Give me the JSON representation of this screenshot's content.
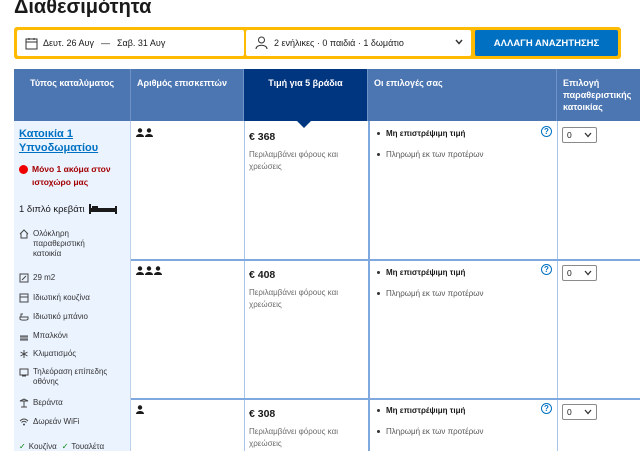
{
  "page": {
    "title": "Διαθεσιμότητα"
  },
  "search": {
    "checkin": "Δευτ. 26 Αυγ",
    "separator": "—",
    "checkout": "Σαβ. 31 Αυγ",
    "guests": "2 ενήλικες · 0 παιδιά · 1 δωμάτιο",
    "button": "ΑΛΛΑΓΗ ΑΝΑΖΗΤΗΣΗΣ"
  },
  "table": {
    "headers": [
      "Τύπος καταλύματος",
      "Αριθμός επισκεπτών",
      "Τιμή για 5 βράδια",
      "Οι επιλογές σας",
      "Επιλογή παραθεριστικής κατοικίας"
    ]
  },
  "room": {
    "name": "Κατοικία 1 Υπνοδωματίου",
    "scarcity": "Μόνο 1 ακόμα στον ιστοχώρο μας",
    "bed": "1 διπλό κρεβάτι",
    "facilities": [
      {
        "label": "Ολόκληρη παραθεριστική κατοικία",
        "icon": "house-icon"
      },
      {
        "label": "29 m2",
        "icon": "size-icon"
      },
      {
        "label": "Ιδιωτική κουζίνα",
        "icon": "kitchen-icon"
      },
      {
        "label": "Ιδιωτικό μπάνιο",
        "icon": "bath-icon"
      },
      {
        "label": "Μπαλκόνι",
        "icon": "balcony-icon"
      },
      {
        "label": "Κλιματισμός",
        "icon": "snowflake-icon"
      },
      {
        "label": "Τηλεόραση επίπεδης οθόνης",
        "icon": "tv-icon"
      },
      {
        "label": "Βεράντα",
        "icon": "terrace-icon"
      },
      {
        "label": "Δωρεάν WiFi",
        "icon": "wifi-icon"
      }
    ],
    "amenities": [
      "Κουζίνα",
      "Τουαλέτα"
    ]
  },
  "offers": [
    {
      "guests": 2,
      "price": "€ 368",
      "note": "Περιλαμβάνει φόρους και χρεώσεις",
      "options": [
        "Μη επιστρέψιμη τιμή",
        "Πληρωμή εκ των προτέρων"
      ],
      "select_value": "0"
    },
    {
      "guests": 3,
      "price": "€ 408",
      "note": "Περιλαμβάνει φόρους και χρεώσεις",
      "options": [
        "Μη επιστρέψιμη τιμή",
        "Πληρωμή εκ των προτέρων"
      ],
      "select_value": "0"
    },
    {
      "guests": 1,
      "price": "€ 308",
      "note": "Περιλαμβάνει φόρους και χρεώσεις",
      "options": [
        "Μη επιστρέψιμη τιμή",
        "Πληρωμή εκ των προτέρων"
      ],
      "select_value": "0"
    }
  ],
  "colors": {
    "header_blue": "#4c76b2",
    "active_header": "#003580",
    "accent_yellow": "#febb02",
    "button_blue": "#0071c2",
    "scarcity_red": "#a30000"
  }
}
